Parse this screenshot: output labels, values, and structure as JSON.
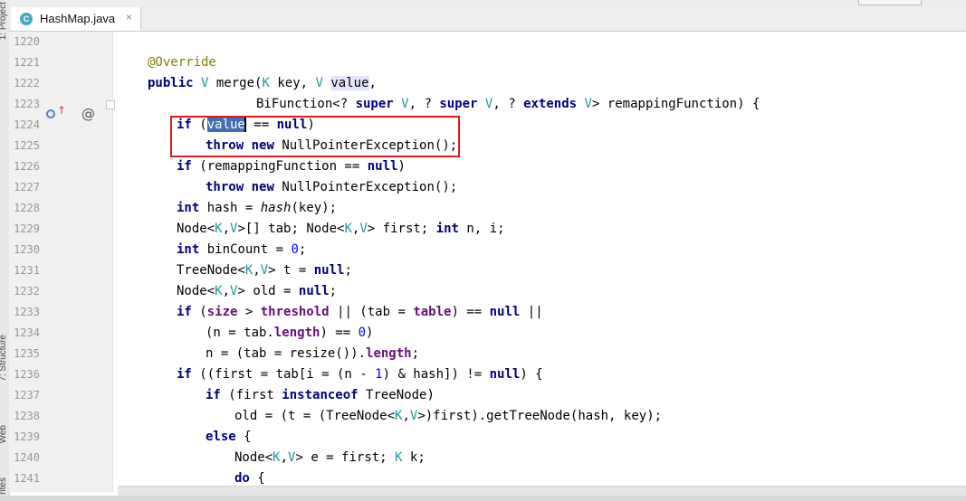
{
  "editor": {
    "tab": {
      "icon_text": "C",
      "label": "HashMap.java",
      "close": "×"
    },
    "side_labels": {
      "project": "1: Project",
      "structure": "7: Structure",
      "web": "Web",
      "favorites": "rites"
    },
    "line_numbers": [
      "1220",
      "1221",
      "1222",
      "1223",
      "1224",
      "1225",
      "1226",
      "1227",
      "1228",
      "1229",
      "1230",
      "1231",
      "1232",
      "1233",
      "1234",
      "1235",
      "1236",
      "1237",
      "1238",
      "1239",
      "1240",
      "1241"
    ],
    "gutter_icons": {
      "at": "@",
      "arrow": "↑"
    },
    "code": {
      "l1221": {
        "ann": "@Override"
      },
      "l1222": {
        "kw_public": "public",
        "type_v": "V",
        "t1": " merge(",
        "type_k": "K",
        "t2": " key, ",
        "type_v2": "V",
        "sp": " ",
        "param": "value",
        "t3": ","
      },
      "l1223": {
        "t1": "BiFunction<? ",
        "kw1": "super",
        "sp1": " ",
        "type_v": "V",
        "t2": ", ? ",
        "kw2": "super",
        "sp2": " ",
        "type_v2": "V",
        "t3": ", ? ",
        "kw3": "extends",
        "sp3": " ",
        "type_v3": "V",
        "t4": "> remappingFunction) {"
      },
      "l1224": {
        "kw_if": "if",
        "t1": " (",
        "sel": "value",
        "t2": " == ",
        "kw_null": "null",
        "t3": ")"
      },
      "l1225": {
        "kw_throw": "throw",
        "sp": " ",
        "kw_new": "new",
        "t1": " NullPointerException();"
      },
      "l1226": {
        "kw_if": "if",
        "t1": " (remappingFunction == ",
        "kw_null": "null",
        "t2": ")"
      },
      "l1227": {
        "kw_throw": "throw",
        "sp": " ",
        "kw_new": "new",
        "t1": " NullPointerException();"
      },
      "l1228": {
        "kw_int": "int",
        "t1": " hash = ",
        "ital": "hash",
        "t2": "(key);"
      },
      "l1229": {
        "t1": "Node<",
        "tk": "K",
        "c1": ",",
        "tv": "V",
        "t2": ">[] tab; Node<",
        "tk2": "K",
        "c2": ",",
        "tv2": "V",
        "t3": "> first; ",
        "kw_int": "int",
        "t4": " n, i;"
      },
      "l1230": {
        "kw_int": "int",
        "t1": " binCount = ",
        "num": "0",
        "t2": ";"
      },
      "l1231": {
        "t1": "TreeNode<",
        "tk": "K",
        "c1": ",",
        "tv": "V",
        "t2": "> t = ",
        "kw_null": "null",
        "t3": ";"
      },
      "l1232": {
        "t1": "Node<",
        "tk": "K",
        "c1": ",",
        "tv": "V",
        "t2": "> old = ",
        "kw_null": "null",
        "t3": ";"
      },
      "l1233": {
        "kw_if": "if",
        "t1": " (",
        "f1": "size",
        "t2": " > ",
        "f2": "threshold",
        "t3": " || (tab = ",
        "f3": "table",
        "t4": ") == ",
        "kw_null": "null",
        "t5": " ||"
      },
      "l1234": {
        "t1": "(n = tab.",
        "f1": "length",
        "t2": ") == ",
        "num": "0",
        "t3": ")"
      },
      "l1235": {
        "t1": "n = (tab = resize()).",
        "f1": "length",
        "t2": ";"
      },
      "l1236": {
        "kw_if": "if",
        "t1": " ((first = tab[i = (n - ",
        "num": "1",
        "t2": ") & hash]) != ",
        "kw_null": "null",
        "t3": ") {"
      },
      "l1237": {
        "kw_if": "if",
        "t1": " (first ",
        "kw_inst": "instanceof",
        "t2": " TreeNode)"
      },
      "l1238": {
        "t1": "old = (t = (TreeNode<",
        "tk": "K",
        "c1": ",",
        "tv": "V",
        "t2": ">)first).getTreeNode(hash, key);"
      },
      "l1239": {
        "kw_else": "else",
        "t1": " {"
      },
      "l1240": {
        "t1": "Node<",
        "tk": "K",
        "c1": ",",
        "tv": "V",
        "t2": "> e = first; ",
        "tk2": "K",
        "t3": " k;"
      },
      "l1241": {
        "kw_do": "do",
        "t1": " {"
      }
    },
    "colors": {
      "keyword": "#000080",
      "annotation": "#808000",
      "type_param": "#20999d",
      "number": "#0000ff",
      "field": "#660e7a",
      "highlight_box": "#e01a1a",
      "selection": "#3f6fb4"
    }
  }
}
